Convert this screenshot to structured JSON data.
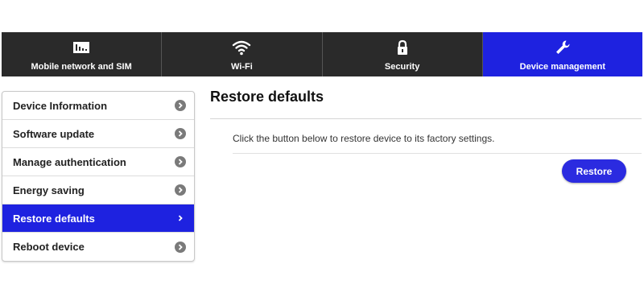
{
  "topnav": {
    "tabs": [
      {
        "label": "Mobile network and SIM",
        "icon": "signal-icon"
      },
      {
        "label": "Wi-Fi",
        "icon": "wifi-icon"
      },
      {
        "label": "Security",
        "icon": "lock-icon"
      },
      {
        "label": "Device management",
        "icon": "wrench-icon"
      }
    ],
    "active_tab": "Device management",
    "colors": {
      "bar": "#2a2a2a",
      "active": "#1e22e0"
    }
  },
  "sidebar": {
    "items": [
      {
        "label": "Device Information"
      },
      {
        "label": "Software update"
      },
      {
        "label": "Manage authentication"
      },
      {
        "label": "Energy saving"
      },
      {
        "label": "Restore defaults"
      },
      {
        "label": "Reboot device"
      }
    ],
    "active_item": "Restore defaults"
  },
  "main": {
    "title": "Restore defaults",
    "description": "Click the button below to restore device to its factory settings.",
    "restore_button": "Restore"
  }
}
